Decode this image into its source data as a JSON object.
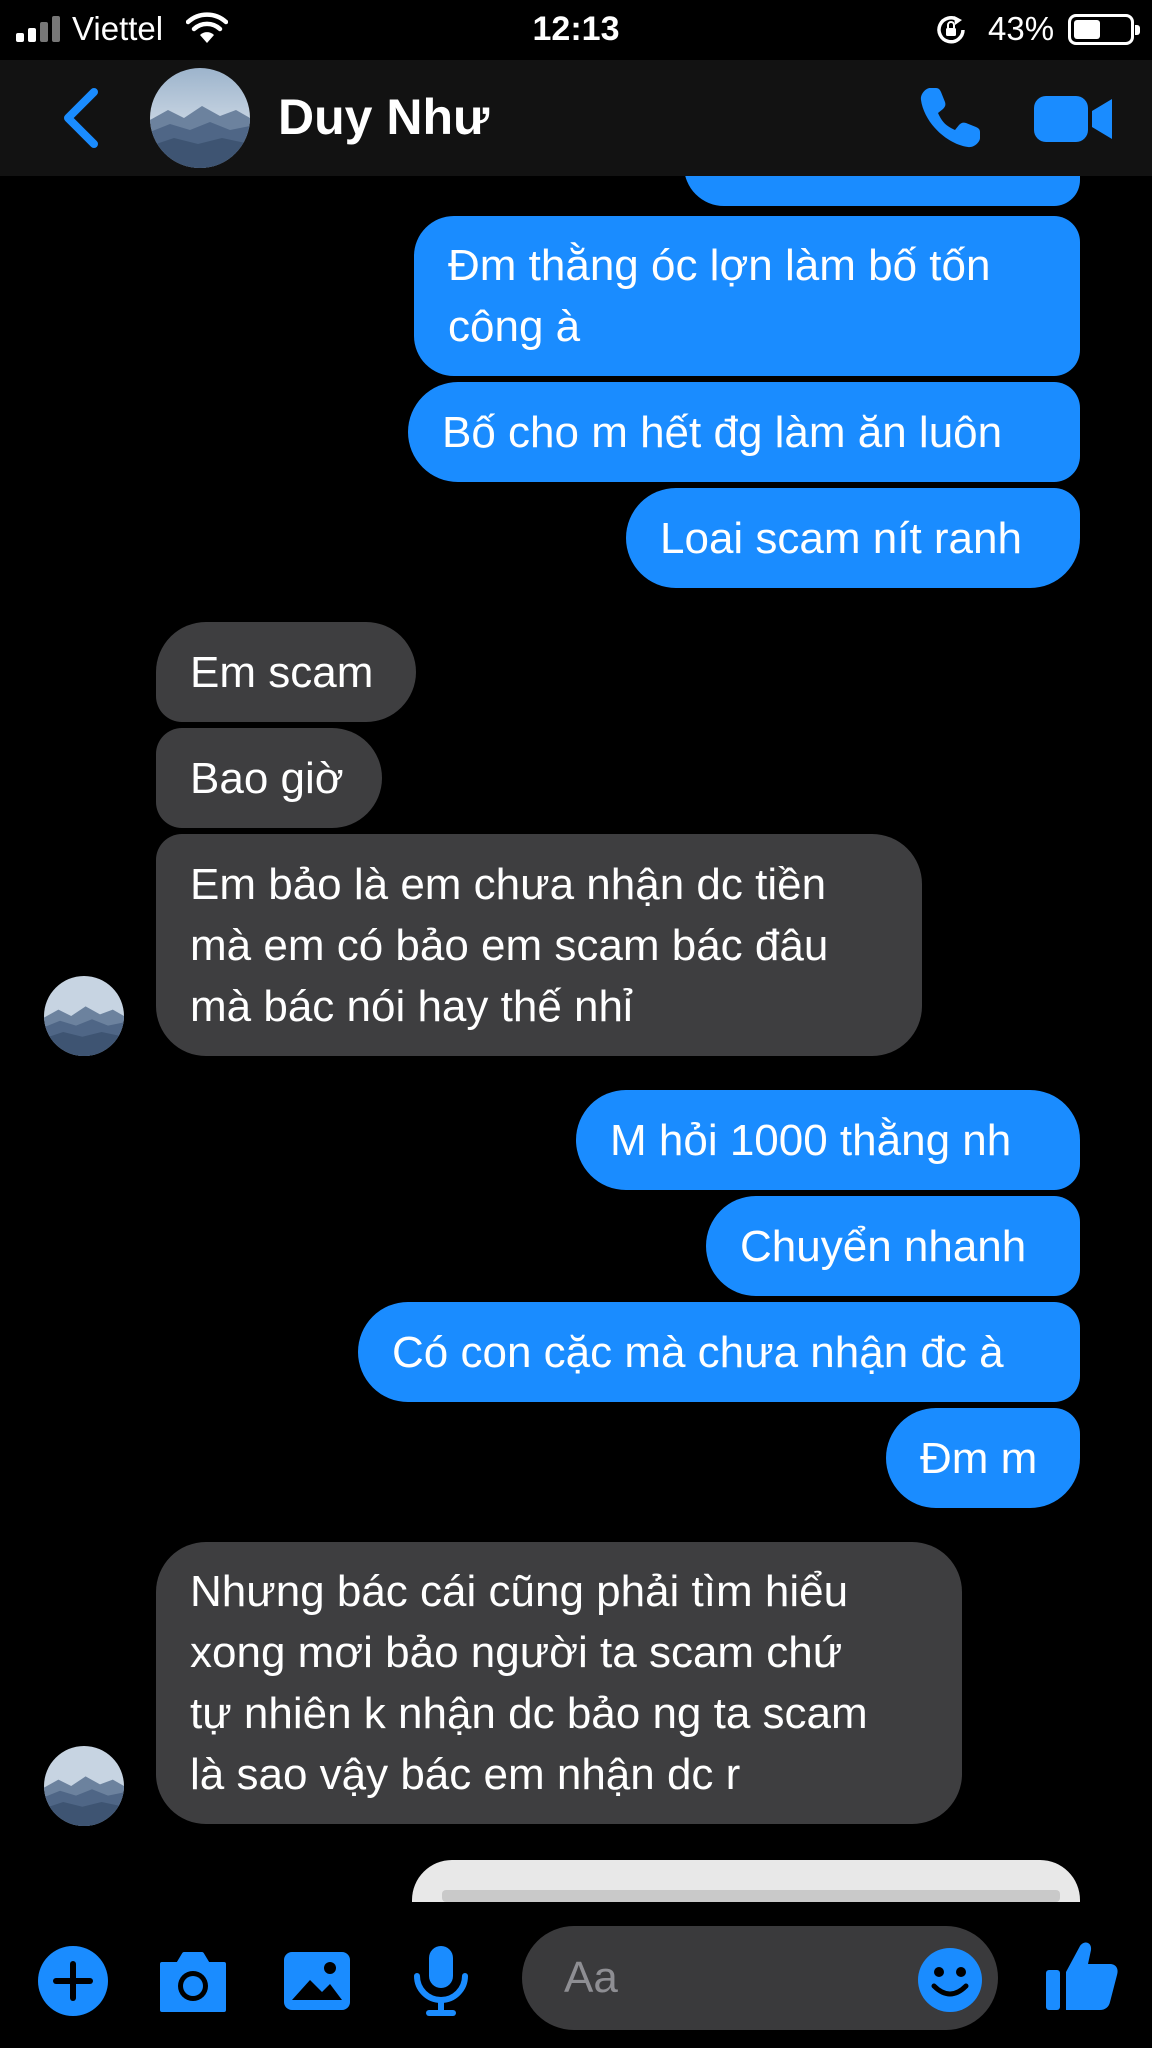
{
  "colors": {
    "accent": "#1a8cff",
    "outgoing_bubble": "#1a8cff",
    "incoming_bubble": "#3e3e40",
    "background": "#000000",
    "header": "#121212"
  },
  "status_bar": {
    "carrier": "Viettel",
    "time": "12:13",
    "battery": "43%",
    "icons": [
      "signal-icon",
      "wifi-icon",
      "rotation-lock-icon",
      "battery-icon"
    ]
  },
  "header": {
    "contact_name": "Duy Như",
    "icons": [
      "back-chevron-icon",
      "phone-icon",
      "video-camera-icon"
    ]
  },
  "messages": [
    {
      "dir": "out",
      "lines": [
        "Đm thằng óc lợn làm bố tốn",
        "công à"
      ]
    },
    {
      "dir": "out",
      "lines": [
        "Bố cho m hết đg làm ăn luôn"
      ]
    },
    {
      "dir": "out",
      "lines": [
        "Loai scam nít ranh"
      ]
    },
    {
      "dir": "in",
      "lines": [
        "Em scam"
      ]
    },
    {
      "dir": "in",
      "lines": [
        "Bao giờ"
      ]
    },
    {
      "dir": "in",
      "lines": [
        "Em bảo là em chưa nhận dc tiền",
        "mà em có bảo em scam bác đâu",
        "mà bác nói hay thế nhỉ"
      ]
    },
    {
      "dir": "out",
      "lines": [
        "M hỏi 1000 thằng nh"
      ]
    },
    {
      "dir": "out",
      "lines": [
        "Chuyển nhanh"
      ]
    },
    {
      "dir": "out",
      "lines": [
        "Có con cặc mà chưa nhận đc à"
      ]
    },
    {
      "dir": "out",
      "lines": [
        "Đm m"
      ]
    },
    {
      "dir": "in",
      "lines": [
        "Nhưng bác cái cũng phải tìm hiểu",
        "xong mơi bảo người ta scam chứ",
        "tự nhiên k nhận dc bảo ng ta scam",
        "là sao vậy bác em nhận dc r"
      ]
    }
  ],
  "composer": {
    "placeholder": "Aa",
    "icons": [
      "plus-icon",
      "camera-icon",
      "photo-icon",
      "microphone-icon",
      "emoji-icon",
      "thumbs-up-icon"
    ]
  }
}
